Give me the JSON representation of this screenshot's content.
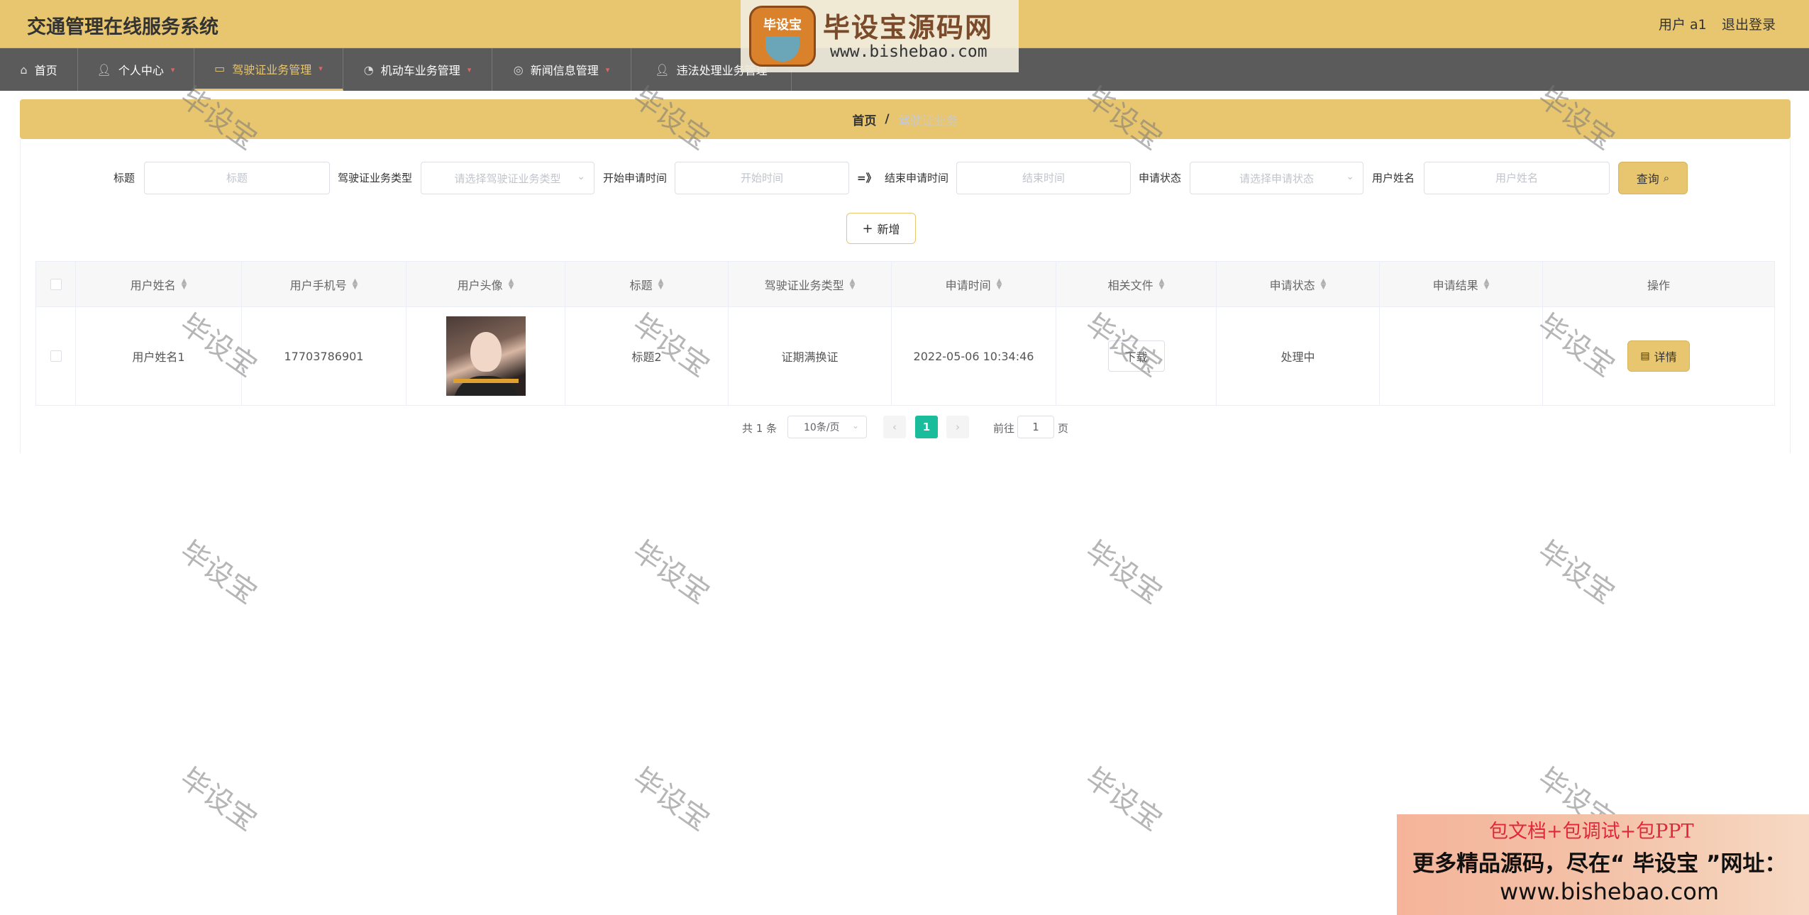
{
  "header": {
    "app_title": "交通管理在线服务系统",
    "user_label": "用户 a1",
    "logout_label": "退出登录"
  },
  "nav": {
    "items": [
      {
        "label": "首页",
        "icon": "home-icon"
      },
      {
        "label": "个人中心",
        "icon": "user-icon"
      },
      {
        "label": "驾驶证业务管理",
        "icon": "chat-icon"
      },
      {
        "label": "机动车业务管理",
        "icon": "dashboard-icon"
      },
      {
        "label": "新闻信息管理",
        "icon": "globe-icon"
      },
      {
        "label": "违法处理业务管理",
        "icon": "user-icon"
      }
    ],
    "active_index": 2
  },
  "breadcrumb": {
    "home": "首页",
    "separator": "/",
    "current": "驾驶证业务"
  },
  "search": {
    "title_label": "标题",
    "title_placeholder": "标题",
    "type_label": "驾驶证业务类型",
    "type_placeholder": "请选择驾驶证业务类型",
    "start_label": "开始申请时间",
    "start_placeholder": "开始时间",
    "range_sep": "=》",
    "end_label": "结束申请时间",
    "end_placeholder": "结束时间",
    "status_label": "申请状态",
    "status_placeholder": "请选择申请状态",
    "username_label": "用户姓名",
    "username_placeholder": "用户姓名",
    "query_button": "查询"
  },
  "actions": {
    "add_button": "新增"
  },
  "table": {
    "columns": [
      "用户姓名",
      "用户手机号",
      "用户头像",
      "标题",
      "驾驶证业务类型",
      "申请时间",
      "相关文件",
      "申请状态",
      "申请结果",
      "操作"
    ],
    "rows": [
      {
        "username": "用户姓名1",
        "phone": "17703786901",
        "title": "标题2",
        "type": "证期满换证",
        "apply_time": "2022-05-06 10:34:46",
        "file_button": "下载",
        "status": "处理中",
        "result": "",
        "detail_button": "详情"
      }
    ]
  },
  "pagination": {
    "total": "共 1 条",
    "page_size": "10条/页",
    "prev": "‹",
    "current_page": "1",
    "next": "›",
    "goto_label": "前往",
    "goto_value": "1",
    "page_suffix": "页"
  },
  "watermark": {
    "logo_badge": "毕设宝",
    "logo_title": "毕设宝源码网",
    "logo_url": "www.bishebao.com",
    "tile_text": "毕设宝"
  },
  "promo": {
    "line1": "包文档+包调试+包PPT",
    "line2": "更多精品源码，尽在“ 毕设宝 ”网址：",
    "line3": "www.bishebao.com"
  },
  "colors": {
    "accent": "#e8c66f",
    "nav_bg": "#5b5b5b",
    "page_active": "#1abc9c"
  }
}
